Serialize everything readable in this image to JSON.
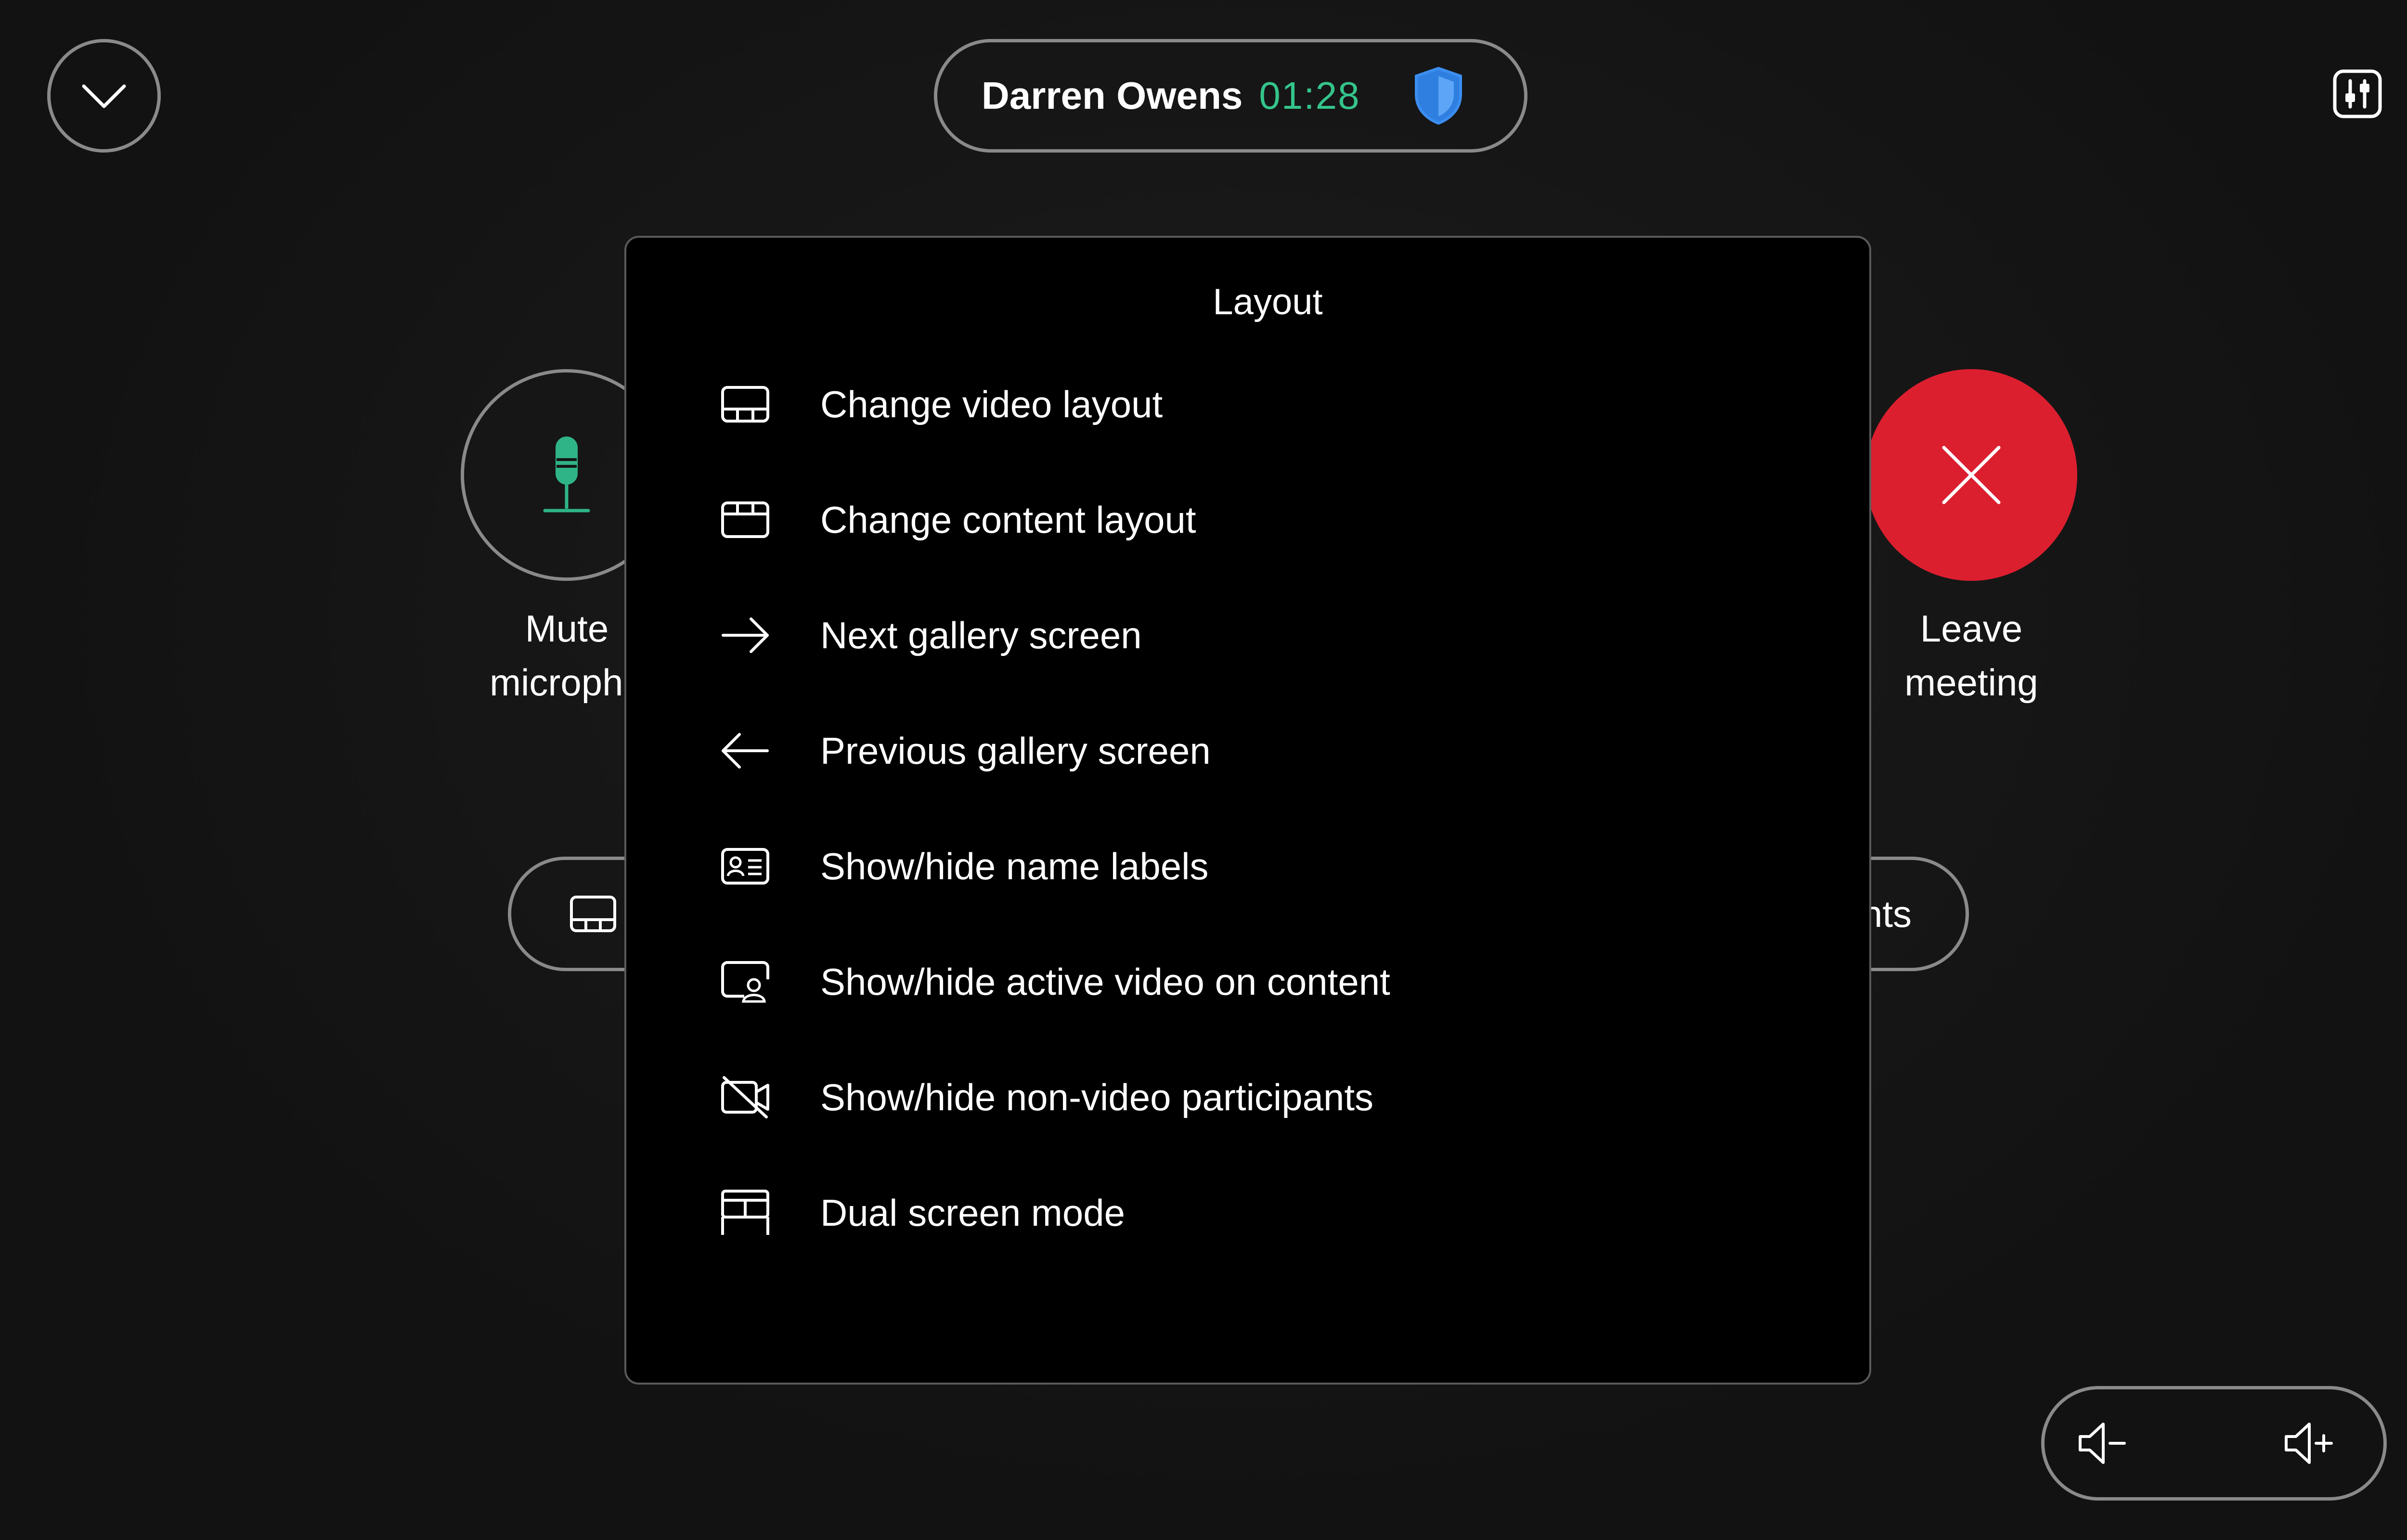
{
  "call": {
    "participant_name": "Darren Owens",
    "duration": "01:28"
  },
  "controls": {
    "mute_label": "Mute\nmicropho",
    "leave_label": "Leave\nmeeting",
    "participants_pill_label": "nts"
  },
  "layout_menu": {
    "title": "Layout",
    "items": [
      {
        "label": "Change video layout",
        "icon": "video-layout-icon"
      },
      {
        "label": "Change content layout",
        "icon": "content-layout-icon"
      },
      {
        "label": "Next gallery screen",
        "icon": "arrow-right-icon"
      },
      {
        "label": "Previous gallery screen",
        "icon": "arrow-left-icon"
      },
      {
        "label": "Show/hide name labels",
        "icon": "name-label-icon"
      },
      {
        "label": "Show/hide active video on content",
        "icon": "active-video-icon"
      },
      {
        "label": "Show/hide non-video participants",
        "icon": "video-off-icon"
      },
      {
        "label": "Dual screen mode",
        "icon": "dual-screen-icon"
      }
    ]
  },
  "colors": {
    "accent_green": "#34c48b",
    "leave_red": "#dc1f2f",
    "shield_blue": "#3b8ef0"
  }
}
